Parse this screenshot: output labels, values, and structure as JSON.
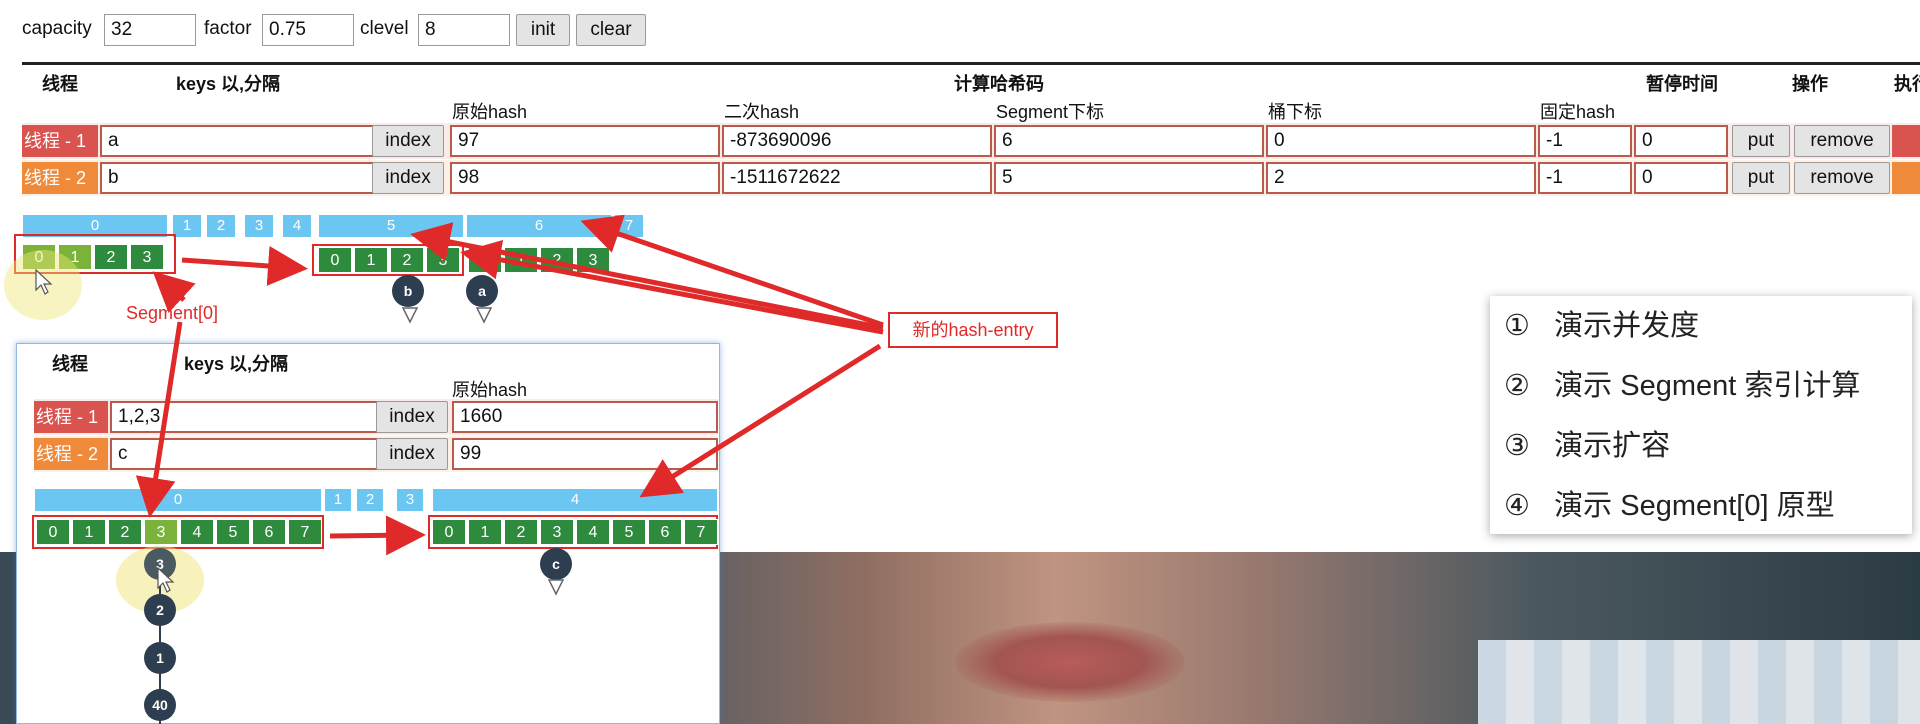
{
  "controls": {
    "capacity_label": "capacity",
    "capacity_value": "32",
    "factor_label": "factor",
    "factor_value": "0.75",
    "clevel_label": "clevel",
    "clevel_value": "8",
    "init_label": "init",
    "clear_label": "clear"
  },
  "table": {
    "headers": {
      "thread": "线程",
      "keys": "keys 以,分隔",
      "compute_hash": "计算哈希码",
      "pause_time": "暂停时间",
      "operation": "操作",
      "execute": "执行"
    },
    "subheaders": {
      "raw_hash": "原始hash",
      "second_hash": "二次hash",
      "segment_index": "Segment下标",
      "bucket_index": "桶下标",
      "fixed_hash": "固定hash"
    },
    "rows": [
      {
        "thread": "线程 - 1",
        "key": "a",
        "index_label": "index",
        "raw_hash": "97",
        "second_hash": "-873690096",
        "segment_index": "6",
        "bucket_index": "0",
        "fixed_hash": "-1",
        "pause": "0",
        "put_label": "put",
        "remove_label": "remove"
      },
      {
        "thread": "线程 - 2",
        "key": "b",
        "index_label": "index",
        "raw_hash": "98",
        "second_hash": "-1511672622",
        "segment_index": "5",
        "bucket_index": "2",
        "fixed_hash": "-1",
        "pause": "0",
        "put_label": "put",
        "remove_label": "remove"
      }
    ]
  },
  "segments_top": {
    "segments": [
      "0",
      "1",
      "2",
      "3",
      "4",
      "5",
      "6",
      "7"
    ],
    "seg0_slots": [
      "0",
      "1",
      "2",
      "3"
    ],
    "new_slots": [
      "0",
      "1",
      "2",
      "3"
    ],
    "seg6_slots": [
      "0",
      "1",
      "2",
      "3"
    ],
    "nodes": [
      "b",
      "a"
    ]
  },
  "annotations": {
    "segment0": "Segment[0]",
    "new_entry": "新的hash-entry"
  },
  "inner_panel": {
    "headers": {
      "thread": "线程",
      "keys": "keys 以,分隔",
      "raw_hash": "原始hash"
    },
    "rows": [
      {
        "thread": "线程 - 1",
        "key": "1,2,3",
        "index_label": "index",
        "raw_hash": "1660"
      },
      {
        "thread": "线程 - 2",
        "key": "c",
        "index_label": "index",
        "raw_hash": "99"
      }
    ],
    "segments": [
      "0",
      "1",
      "2",
      "3",
      "4"
    ],
    "old_slots": [
      "0",
      "1",
      "2",
      "3",
      "4",
      "5",
      "6",
      "7"
    ],
    "new_slots": [
      "0",
      "1",
      "2",
      "3",
      "4",
      "5",
      "6",
      "7"
    ],
    "chain": [
      "3",
      "2",
      "1",
      "40"
    ],
    "node_c": "c"
  },
  "menu": {
    "items": [
      {
        "num": "①",
        "text": "演示并发度"
      },
      {
        "num": "②",
        "text": "演示 Segment 索引计算"
      },
      {
        "num": "③",
        "text": "演示扩容"
      },
      {
        "num": "④",
        "text": "演示 Segment[0] 原型"
      }
    ]
  },
  "colors": {
    "thread1": "#d9534f",
    "thread2": "#ef8a3a",
    "segment": "#6cc6f2",
    "slot": "#2e8b3e",
    "annotation": "#e02a2a"
  }
}
